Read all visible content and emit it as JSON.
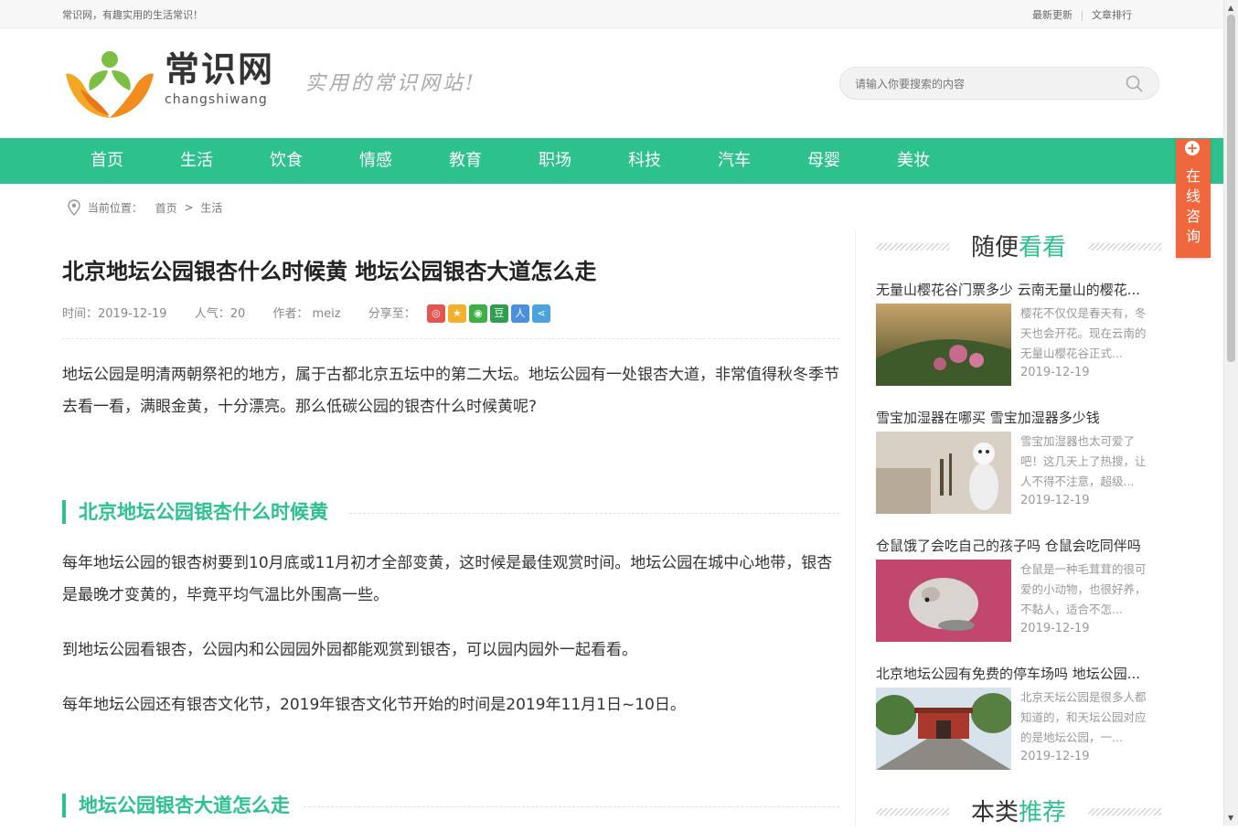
{
  "topbar": {
    "slogan": "常识网，有趣实用的生活常识！",
    "links": [
      "最新更新",
      "文章排行"
    ]
  },
  "header": {
    "brand_cn": "常识网",
    "brand_pinyin": "changshiwang",
    "tagline": "实用的常识网站!",
    "search_placeholder": "请输入你要搜索的内容"
  },
  "nav": [
    "首页",
    "生活",
    "饮食",
    "情感",
    "教育",
    "职场",
    "科技",
    "汽车",
    "母婴",
    "美妆"
  ],
  "consult": {
    "label": "在线咨询"
  },
  "breadcrumb": {
    "prefix": "当前位置：",
    "home": "首页",
    "sep": ">",
    "current": "生活"
  },
  "article": {
    "title": "北京地坛公园银杏什么时候黄 地坛公园银杏大道怎么走",
    "time": "时间：2019-12-19",
    "views": "人气：20",
    "author": "作者： meiz",
    "share_label": "分享至：",
    "intro": "地坛公园是明清两朝祭祀的地方，属于古都北京五坛中的第二大坛。地坛公园有一处银杏大道，非常值得秋冬季节去看一看，满眼金黄，十分漂亮。那么低碳公园的银杏什么时候黄呢?",
    "h2_1": "北京地坛公园银杏什么时候黄",
    "p1": "每年地坛公园的银杏树要到10月底或11月初才全部变黄，这时候是最佳观赏时间。地坛公园在城中心地带，银杏是最晚才变黄的，毕竟平均气温比外围高一些。",
    "p2": "到地坛公园看银杏，公园内和公园园外园都能观赏到银杏，可以园内园外一起看看。",
    "p3": "每年地坛公园还有银杏文化节，2019年银杏文化节开始的时间是2019年11月1日~10日。",
    "h2_2": "地坛公园银杏大道怎么走"
  },
  "sidebar": {
    "title_a": "随便",
    "title_b": "看看",
    "items": [
      {
        "title": "无量山樱花谷门票多少 云南无量山的樱花...",
        "desc": "樱花不仅仅是春天有，冬天也会开花。现在云南的无量山樱花谷正式...",
        "date": "2019-12-19"
      },
      {
        "title": "雪宝加湿器在哪买 雪宝加湿器多少钱",
        "desc": "雪宝加湿器也太可爱了吧！这几天上了热搜，让人不得不注意，超级...",
        "date": "2019-12-19"
      },
      {
        "title": "仓鼠饿了会吃自己的孩子吗 仓鼠会吃同伴吗",
        "desc": "仓鼠是一种毛茸茸的很可爱的小动物，也很好养，不黏人，适合不怎...",
        "date": "2019-12-19"
      },
      {
        "title": "北京地坛公园有免费的停车场吗 地坛公园...",
        "desc": "北京天坛公园是很多人都知道的，和天坛公园对应的是地坛公园，一...",
        "date": "2019-12-19"
      }
    ],
    "title2_a": "本类",
    "title2_b": "推荐"
  },
  "colors": {
    "brand_green": "#2dc28d",
    "consult_orange": "#f0673e"
  }
}
